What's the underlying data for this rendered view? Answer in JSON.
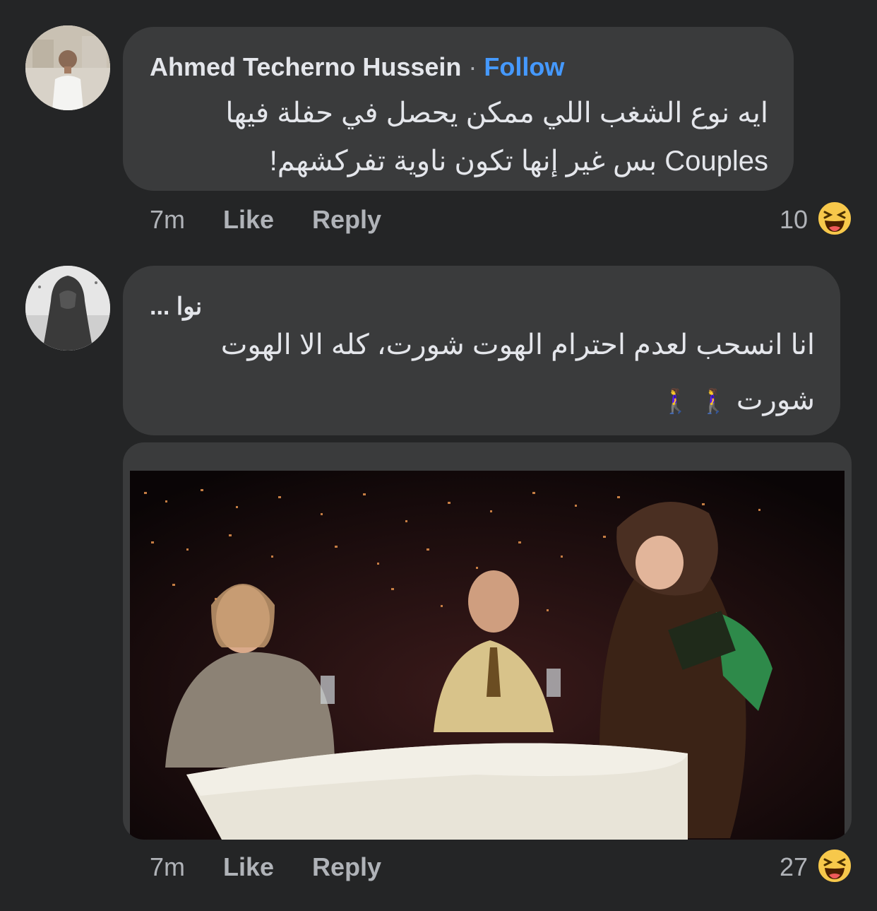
{
  "comments": [
    {
      "author": "Ahmed Techerno Hussein",
      "follow_label": "Follow",
      "separator": "·",
      "text_line1": "ايه نوع الشغب اللي ممكن يحصل في حفلة فيها",
      "text_line2": "Couples بس غير إنها تكون ناوية تفركشهم!",
      "time": "7m",
      "like_label": "Like",
      "reply_label": "Reply",
      "reaction_count": "10",
      "reaction_icon": "laughing-emoji-icon"
    },
    {
      "author": "نوا ...",
      "text_line1": "انا انسحب لعدم احترام الهوت شورت، كله الا الهوت",
      "text_line2": "شورت",
      "emoji": "🚶‍♀️",
      "time": "7m",
      "like_label": "Like",
      "reply_label": "Reply",
      "reaction_count": "27",
      "reaction_icon": "laughing-emoji-icon"
    }
  ],
  "colors": {
    "background": "#242526",
    "bubble": "#3a3b3c",
    "link": "#4599ff",
    "secondary_text": "#b0b3b8"
  }
}
